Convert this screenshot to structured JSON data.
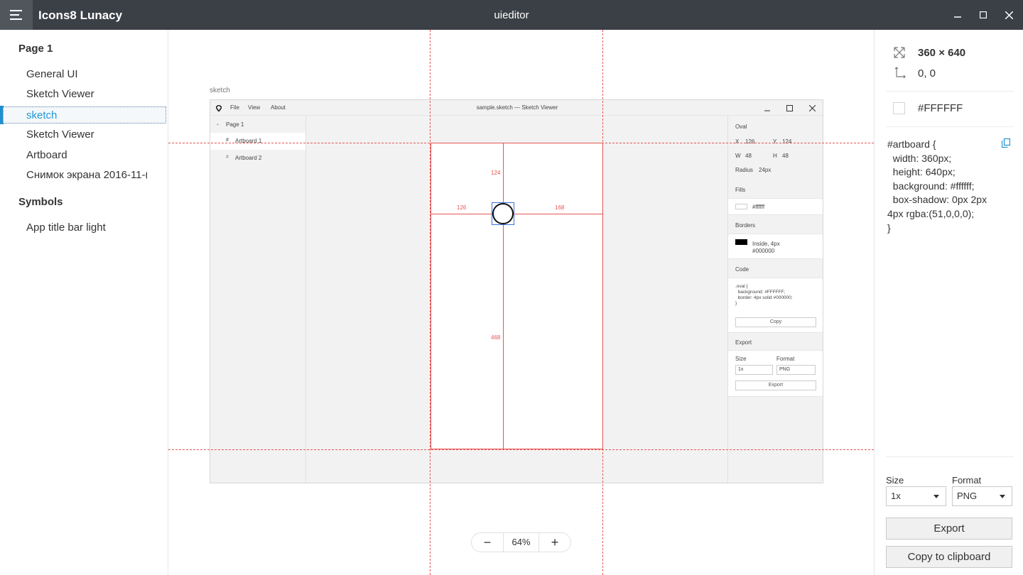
{
  "titlebar": {
    "app_name": "Icons8 Lunacy",
    "doc_title": "uieditor"
  },
  "sidebar": {
    "page_header": "Page 1",
    "items": [
      {
        "label": "General UI"
      },
      {
        "label": "Sketch Viewer"
      },
      {
        "label": "sketch"
      },
      {
        "label": "Sketch Viewer"
      },
      {
        "label": "Artboard"
      },
      {
        "label": "Снимок экрана 2016-11-("
      }
    ],
    "symbols_header": "Symbols",
    "symbols": [
      {
        "label": "App title bar light"
      }
    ]
  },
  "canvas": {
    "artboard_label": "sketch",
    "zoom": {
      "minus": "−",
      "value": "64%",
      "plus": "+"
    },
    "screenshot": {
      "menu": [
        "File",
        "View",
        "About"
      ],
      "title": "sample.sketch — Sketch Viewer",
      "page": "Page 1",
      "artboards": [
        "Artboard 1",
        "Artboard 2"
      ],
      "oval_section": "Oval",
      "x_label": "X",
      "x_value": "126",
      "y_label": "Y",
      "y_value": "124",
      "w_label": "W",
      "w_value": "48",
      "h_label": "H",
      "h_value": "48",
      "radius_label": "Radius",
      "radius_value": "24px",
      "fills_section": "Fills",
      "fill_value": "#ffffff",
      "borders_section": "Borders",
      "border_line1": "Inside, 4px",
      "border_line2": "#000000",
      "code_section": "Code",
      "code_text": ".oval {\n  background: #FFFFFF;\n  border: 4px solid #000000;\n}",
      "copy_button": "Copy",
      "export_section": "Export",
      "size_label": "Size",
      "format_label": "Format",
      "size_value": "1x",
      "format_value": "PNG",
      "export_button": "Export",
      "measure_top": "124",
      "measure_left": "126",
      "measure_right": "168",
      "measure_bottom": "468"
    }
  },
  "inspector": {
    "dimensions": "360 × 640",
    "position": "0, 0",
    "fill": "#FFFFFF",
    "code": "#artboard {\n  width: 360px;\n  height: 640px;\n  background: #ffffff;\n  box-shadow: 0px 2px\n4px rgba:(51,0,0,0);\n}",
    "size_label": "Size",
    "format_label": "Format",
    "size_value": "1x",
    "format_value": "PNG",
    "export_button": "Export",
    "clipboard_button": "Copy to clipboard"
  },
  "colors": {
    "titlebar": "#3b4046",
    "accent": "#2196d4",
    "guides": "#e55555"
  }
}
